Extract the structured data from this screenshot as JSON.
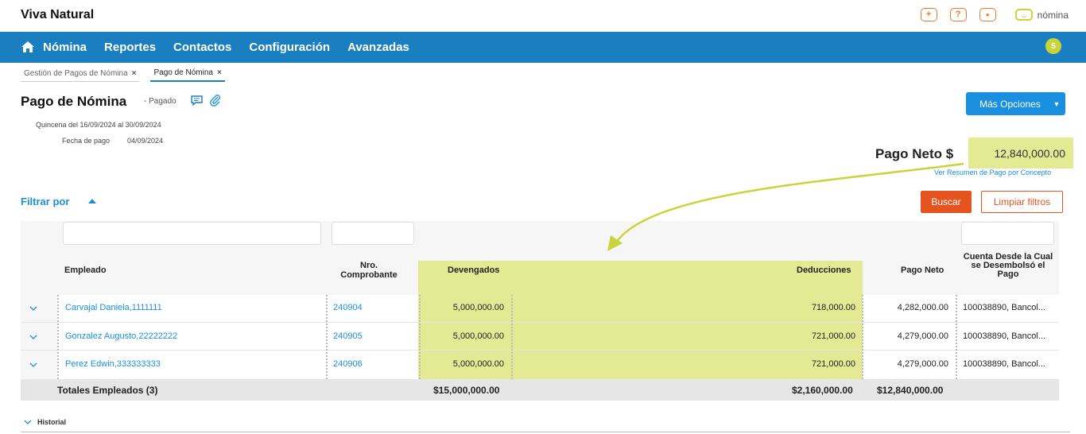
{
  "header": {
    "company": "Viva Natural",
    "icons": [
      "add-icon",
      "help-icon",
      "user-icon"
    ],
    "brand": "nómina",
    "icon_glyphs": {
      "add": "+",
      "help": "?",
      "user": "●"
    },
    "brand_color": "#c9d43a",
    "accent_color": "#e8792f"
  },
  "nav": {
    "items": [
      "Nómina",
      "Reportes",
      "Contactos",
      "Configuración",
      "Avanzadas"
    ],
    "badge": "5",
    "color": "#1a7fc1"
  },
  "tabs": [
    {
      "label": "Gestión de Pagos de Nómina",
      "close": "×",
      "active": false
    },
    {
      "label": "Pago de Nómina",
      "close": "×",
      "active": true
    }
  ],
  "page": {
    "title": "Pago de Nómina",
    "status": "- Pagado",
    "period": "Quincena del 16/09/2024 al 30/09/2024",
    "paydate_label": "Fecha de pago",
    "paydate_value": "04/09/2024",
    "more_options": "Más Opciones",
    "more_caret": "▼"
  },
  "net": {
    "label": "Pago Neto $",
    "value": "12,840,000.00",
    "link": "Ver Resumen de Pago por Concepto",
    "highlight_color": "#e3ea93"
  },
  "filter": {
    "label": "Filtrar por",
    "search": "Buscar",
    "clear": "Limpiar filtros"
  },
  "table": {
    "headers": {
      "employee": "Empleado",
      "voucher": "Nro. Comprobante",
      "earnings": "Devengados",
      "deductions": "Deducciones",
      "net": "Pago Neto",
      "account": "Cuenta Desde la Cual se Desembolsó el Pago"
    },
    "rows": [
      {
        "employee": "Carvajal Daniela,1111111",
        "voucher": "240904",
        "earnings": "5,000,000.00",
        "deductions": "718,000.00",
        "net": "4,282,000.00",
        "account": "100038890, Bancol..."
      },
      {
        "employee": "Gonzalez Augusto,22222222",
        "voucher": "240905",
        "earnings": "5,000,000.00",
        "deductions": "721,000.00",
        "net": "4,279,000.00",
        "account": "100038890, Bancol..."
      },
      {
        "employee": "Perez Edwin,333333333",
        "voucher": "240906",
        "earnings": "5,000,000.00",
        "deductions": "721,000.00",
        "net": "4,279,000.00",
        "account": "100038890, Bancol..."
      }
    ],
    "totals": {
      "label": "Totales Empleados (3)",
      "earnings": "$15,000,000.00",
      "deductions": "$2,160,000.00",
      "net": "$12,840,000.00"
    }
  },
  "history": {
    "label": "Historial"
  }
}
